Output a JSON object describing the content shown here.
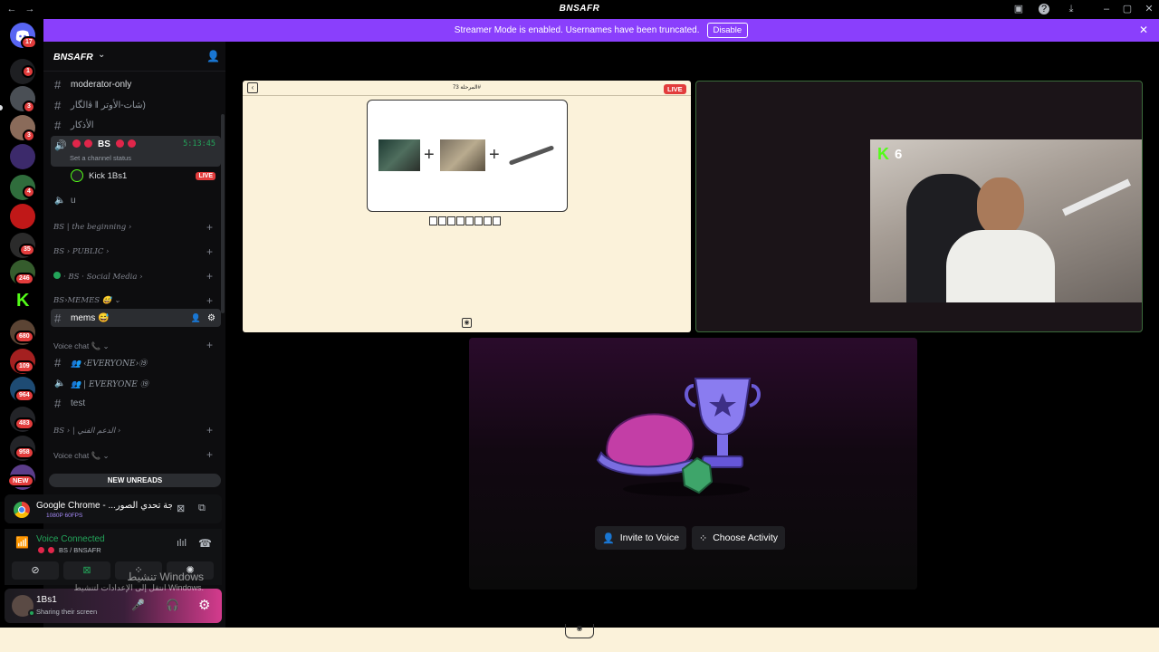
{
  "app": {
    "title": "BNSAFR"
  },
  "banner": {
    "text": "Streamer Mode is enabled. Usernames have been truncated.",
    "disable_label": "Disable"
  },
  "rail": {
    "badges": [
      "17",
      "1",
      "3",
      "3",
      "4",
      "35",
      "246",
      "680",
      "109",
      "964",
      "483",
      "958"
    ],
    "new_label": "NEW"
  },
  "guild": {
    "name": "BNSAFR"
  },
  "channels": {
    "items": [
      {
        "name": "moderator-only"
      },
      {
        "name": "‫(شات-الأوتر‬ ‖ ﭬ‬اﻟﮕﺎﺭ"
      },
      {
        "name": "الأذكار"
      }
    ],
    "stage": {
      "name": "BS",
      "timer": "5:13:45",
      "status": "Set a channel status"
    },
    "member": {
      "name": "Kick 1Bs1",
      "live_label": "LIVE"
    },
    "u_channel": "u",
    "categories": [
      {
        "label": "BS | the beginning"
      },
      {
        "label": "BS › PUBLIC"
      },
      {
        "label": "· BS · Social Media"
      },
      {
        "label": "BS›MEMES 😅"
      }
    ],
    "mems": "mems 😅",
    "voice_cat": "Voice chat 📞",
    "everyone1": "👥 ‹EVERYONE›⑲",
    "everyone2": "👥 | EVERYONE ⑲",
    "test": "test",
    "bs_tech": "BS › | الدعم الفني",
    "voice_cat2": "Voice chat 📞",
    "new_unreads": "NEW UNREADS"
  },
  "chrome_panel": {
    "title": "Google Chrome - ...جة تحدي الصور",
    "quality": "1080P 60FPS"
  },
  "voice": {
    "status": "Voice Connected",
    "channel": "BS / BNSAFR"
  },
  "user": {
    "name": "1Bs1",
    "status": "Sharing their screen"
  },
  "watermark": {
    "line1": "تنشيط Windows",
    "line2": "انتقل إلى الإعدادات لتنشيط Windows."
  },
  "game_tile": {
    "header": "المرحلة 73#",
    "live_label": "LIVE"
  },
  "cam_tile": {
    "kick_count": "6"
  },
  "activity": {
    "invite_label": "Invite to Voice",
    "choose_label": "Choose Activity"
  },
  "colors": {
    "accent": "#8a3ffc",
    "live": "#e23c3c",
    "kick_green": "#53fc18",
    "bg": "#000000"
  }
}
